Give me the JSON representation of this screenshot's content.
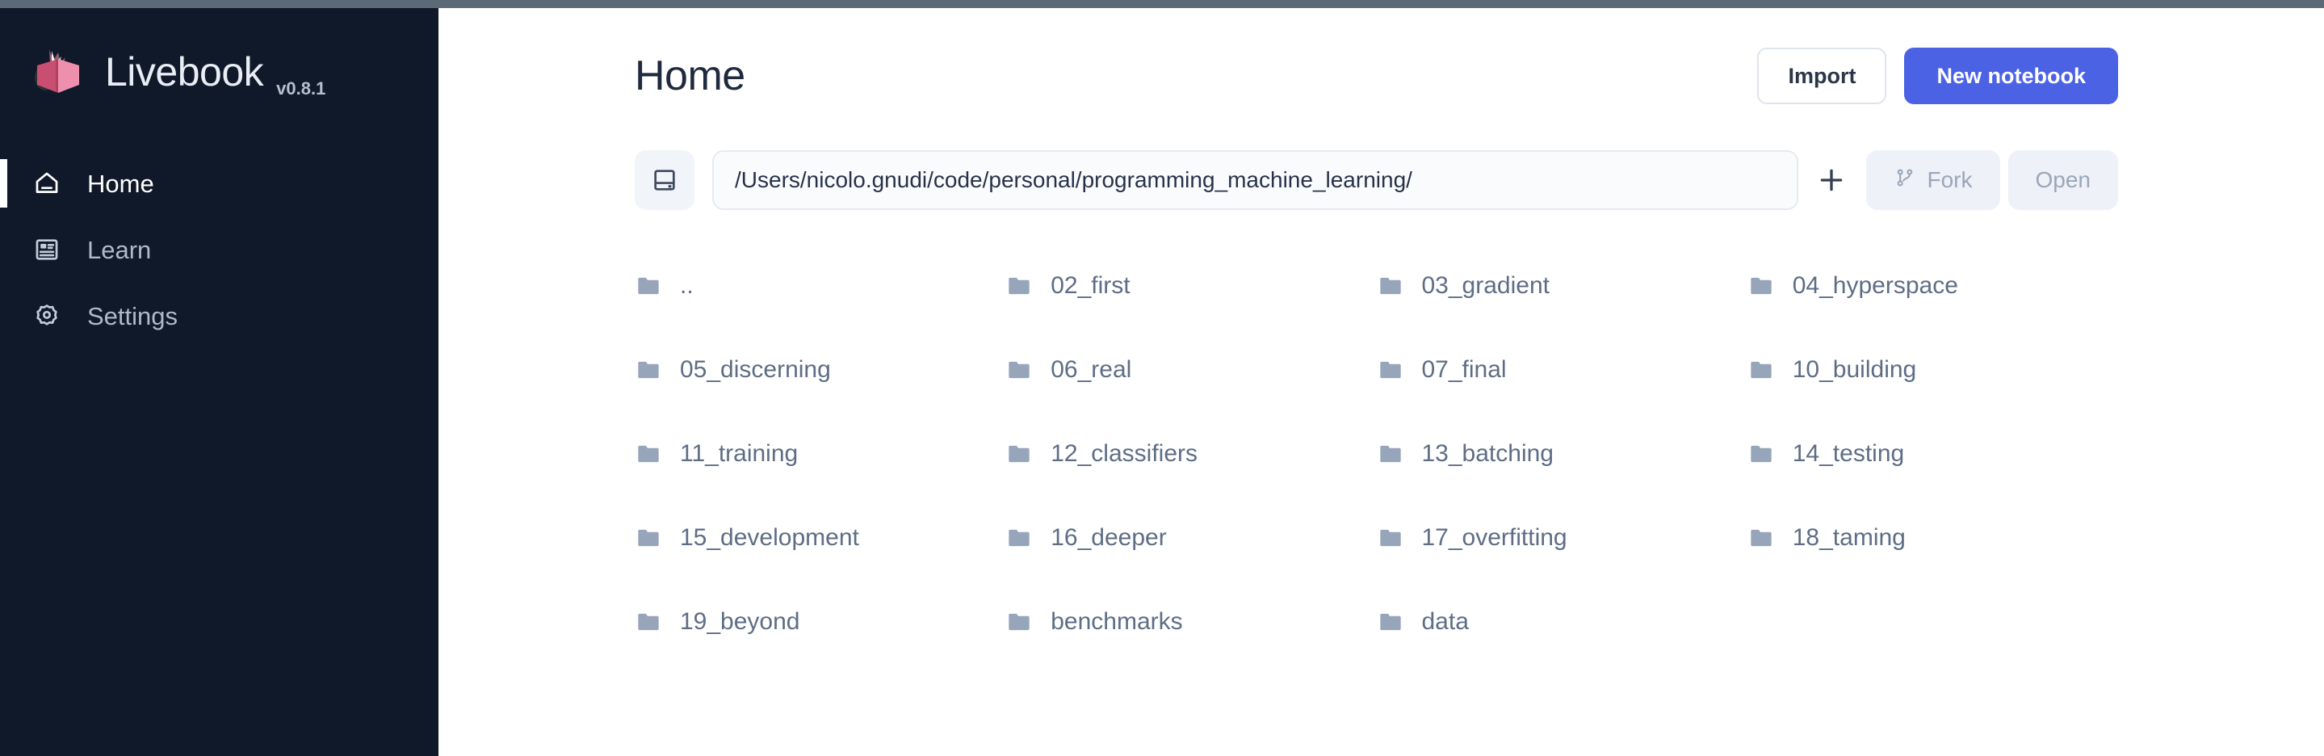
{
  "app": {
    "brand_name": "Livebook",
    "version": "v0.8.1",
    "logo_icon": "livebook-logo-icon"
  },
  "colors": {
    "sidebar_bg": "#101929",
    "primary": "#4b62e5",
    "page_title": "#1f2a3d",
    "file_text": "#5e6d85",
    "folder_icon": "#97a5ba",
    "ghost_button_bg": "#eef1f7",
    "window_strip": "#5c6a77"
  },
  "sidebar": {
    "items": [
      {
        "label": "Home",
        "icon": "home-icon",
        "active": true
      },
      {
        "label": "Learn",
        "icon": "article-icon",
        "active": false
      },
      {
        "label": "Settings",
        "icon": "gear-icon",
        "active": false
      }
    ]
  },
  "header": {
    "title": "Home",
    "import_label": "Import",
    "new_notebook_label": "New notebook"
  },
  "path_bar": {
    "notebook_icon": "notebook-save-icon",
    "value": "/Users/nicolo.gnudi/code/personal/programming_machine_learning/",
    "placeholder": "File path",
    "plus_icon": "plus-icon",
    "fork_label": "Fork",
    "fork_icon": "git-branch-icon",
    "fork_disabled": true,
    "open_label": "Open",
    "open_disabled": true
  },
  "files": {
    "icon": "folder-icon",
    "items": [
      {
        "name": ".."
      },
      {
        "name": "02_first"
      },
      {
        "name": "03_gradient"
      },
      {
        "name": "04_hyperspace"
      },
      {
        "name": "05_discerning"
      },
      {
        "name": "06_real"
      },
      {
        "name": "07_final"
      },
      {
        "name": "10_building"
      },
      {
        "name": "11_training"
      },
      {
        "name": "12_classifiers"
      },
      {
        "name": "13_batching"
      },
      {
        "name": "14_testing"
      },
      {
        "name": "15_development"
      },
      {
        "name": "16_deeper"
      },
      {
        "name": "17_overfitting"
      },
      {
        "name": "18_taming"
      },
      {
        "name": "19_beyond"
      },
      {
        "name": "benchmarks"
      },
      {
        "name": "data"
      }
    ]
  }
}
